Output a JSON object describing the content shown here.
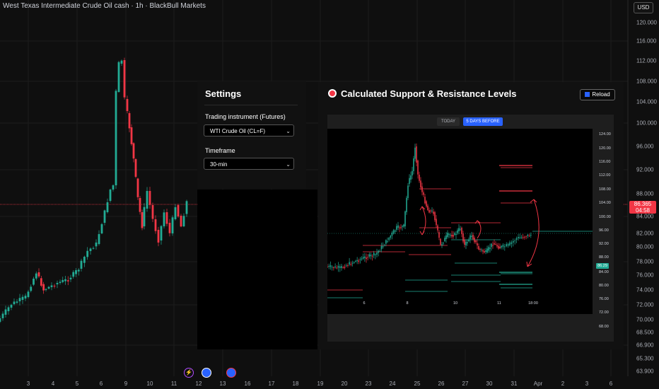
{
  "header": {
    "title": "West Texas Intermediate Crude Oil cash · 1h · BlackBull Markets",
    "currency": "USD"
  },
  "price_axis": [
    "120.000",
    "116.000",
    "112.000",
    "108.000",
    "104.000",
    "100.000",
    "96.000",
    "92.000",
    "88.000",
    "84.000",
    "82.000",
    "80.000",
    "78.000",
    "76.000",
    "74.000",
    "72.000",
    "70.000",
    "68.500",
    "66.900",
    "65.300",
    "63.900"
  ],
  "time_axis": [
    "3",
    "4",
    "5",
    "6",
    "9",
    "10",
    "11",
    "12",
    "13",
    "16",
    "17",
    "18",
    "19",
    "20",
    "23",
    "24",
    "25",
    "26",
    "27",
    "30",
    "31",
    "Apr",
    "2",
    "3",
    "6"
  ],
  "current_price": {
    "value": "86.365",
    "countdown": "04:58"
  },
  "settings": {
    "title": "Settings",
    "instrument_label": "Trading instrument (Futures)",
    "instrument_value": "WTI Crude Oil (CL=F)",
    "timeframe_label": "Timeframe",
    "timeframe_value": "30-min"
  },
  "sr_panel": {
    "title": "Calculated Support & Resistance Levels",
    "reload_label": "Reload",
    "tabs": [
      "TODAY",
      "5 DAYS BEFORE"
    ],
    "active_tab": "5 DAYS BEFORE",
    "price_axis": [
      "124.00",
      "120.00",
      "116.00",
      "112.00",
      "108.00",
      "104.00",
      "100.00",
      "96.00",
      "92.00",
      "88.00",
      "84.00",
      "80.00",
      "76.00",
      "72.00",
      "68.00"
    ],
    "time_axis": [
      "6",
      "8",
      "10",
      "11",
      "18:00"
    ],
    "current_price": "86.29"
  },
  "colors": {
    "up": "#22ab94",
    "down": "#f23645",
    "accent": "#2962ff",
    "background": "#0f0f0f"
  }
}
